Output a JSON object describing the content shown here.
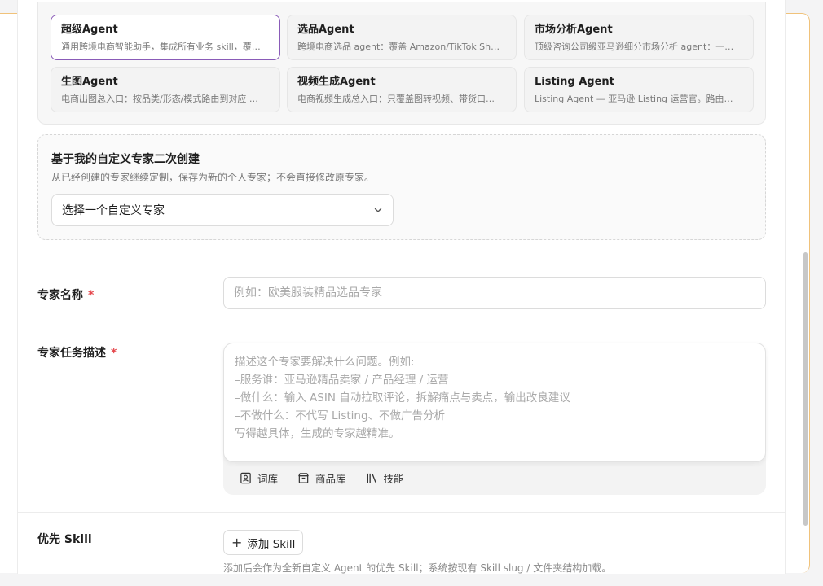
{
  "agents": [
    {
      "name": "超级Agent",
      "desc": "通用跨境电商智能助手，集成所有业务 skill，覆…",
      "selected": true
    },
    {
      "name": "选品Agent",
      "desc": "跨境电商选品 agent：覆盖 Amazon/TikTok Sh…",
      "selected": false
    },
    {
      "name": "市场分析Agent",
      "desc": "顶级咨询公司级亚马逊细分市场分析 agent：一…",
      "selected": false
    },
    {
      "name": "生图Agent",
      "desc": "电商出图总入口：按品类/形态/模式路由到对应 …",
      "selected": false
    },
    {
      "name": "视频生成Agent",
      "desc": "电商视频生成总入口：只覆盖图转视频、带货口…",
      "selected": false
    },
    {
      "name": "Listing Agent",
      "desc": "Listing Agent — 亚马逊 Listing 运营官。路由…",
      "selected": false
    }
  ],
  "custom": {
    "title": "基于我的自定义专家二次创建",
    "subtitle": "从已经创建的专家继续定制，保存为新的个人专家；不会直接修改原专家。",
    "select_value": "选择一个自定义专家"
  },
  "name_field": {
    "label": "专家名称",
    "required_mark": "*",
    "placeholder": "例如：欧美服装精品选品专家"
  },
  "desc_field": {
    "label": "专家任务描述",
    "required_mark": "*",
    "placeholder_lines": [
      "描述这个专家要解决什么问题。例如:",
      "–服务谁：亚马逊精品卖家 / 产品经理 / 运营",
      "–做什么：输入 ASIN 自动拉取评论，拆解痛点与卖点，输出改良建议",
      "–不做什么：不代写 Listing、不做广告分析",
      "写得越具体，生成的专家越精准。"
    ],
    "tools": [
      {
        "label": "词库",
        "icon": "lexicon-icon"
      },
      {
        "label": "商品库",
        "icon": "store-icon"
      },
      {
        "label": "技能",
        "icon": "books-icon"
      }
    ]
  },
  "skill_field": {
    "label": "优先 Skill",
    "add_label": "添加 Skill",
    "hint": "添加后会作为全新自定义 Agent 的优先 Skill；系统按现有 Skill slug / 文件夹结构加载。"
  },
  "colors": {
    "selected_border": "#8a5bb8",
    "required": "#e5484d",
    "frame_accent": "#f0c27a"
  }
}
